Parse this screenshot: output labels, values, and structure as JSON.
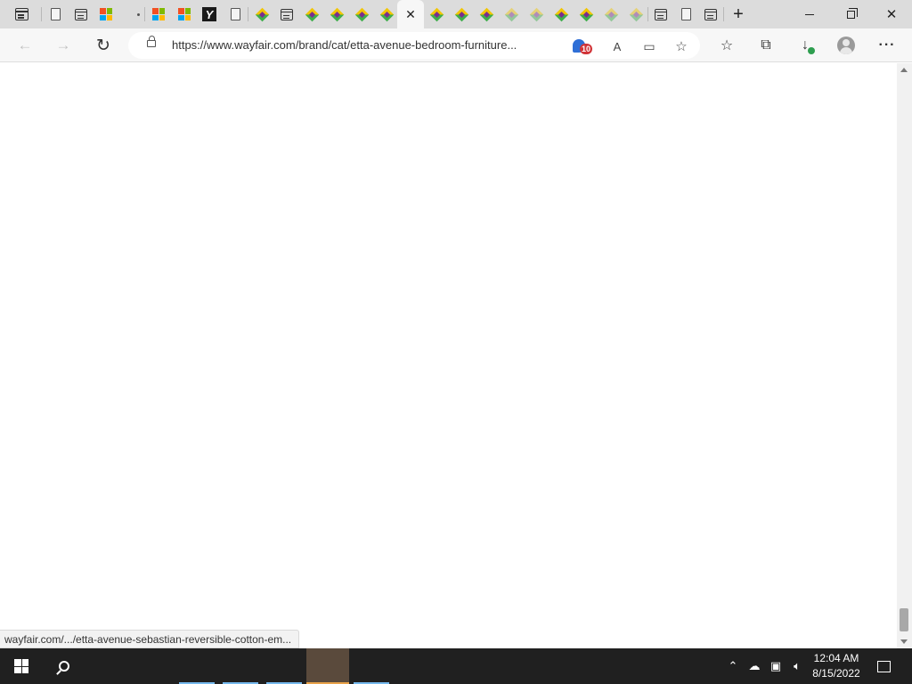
{
  "browser": {
    "address_url": "https://www.wayfair.com/brand/cat/etta-avenue-bedroom-furniture...",
    "tracking_badge_count": "10"
  },
  "tabs": [
    {
      "icon": "tab-actions-icon"
    },
    {
      "icon": "page-icon"
    },
    {
      "icon": "app-window-icon"
    },
    {
      "icon": "microsoft-logo-icon"
    },
    {
      "icon": "loading-dot-icon"
    },
    {
      "icon": "microsoft-logo-icon"
    },
    {
      "icon": "microsoft-logo-icon"
    },
    {
      "icon": "yahoo-logo-icon"
    },
    {
      "icon": "page-icon"
    },
    {
      "icon": "wayfair-logo-icon"
    },
    {
      "icon": "app-window-icon"
    },
    {
      "icon": "wayfair-logo-icon"
    },
    {
      "icon": "wayfair-logo-icon"
    },
    {
      "icon": "wayfair-logo-icon"
    },
    {
      "icon": "wayfair-logo-icon"
    },
    {
      "icon": "close-icon",
      "active": true
    },
    {
      "icon": "wayfair-logo-icon"
    },
    {
      "icon": "wayfair-logo-icon"
    },
    {
      "icon": "wayfair-logo-icon"
    },
    {
      "icon": "wayfair-logo-icon"
    },
    {
      "icon": "wayfair-logo-icon"
    },
    {
      "icon": "wayfair-logo-icon"
    },
    {
      "icon": "wayfair-logo-icon"
    },
    {
      "icon": "wayfair-logo-icon"
    },
    {
      "icon": "wayfair-logo-icon"
    },
    {
      "icon": "app-window-icon"
    },
    {
      "icon": "page-icon"
    },
    {
      "icon": "app-window-icon"
    }
  ],
  "status_bar": {
    "link_url": "wayfair.com/.../etta-avenue-sebastian-reversible-cotton-em..."
  },
  "taskbar": {
    "time": "12:04 AM",
    "date": "8/15/2022",
    "accent": "#76b9ed",
    "active_accent": "#e8a24a"
  }
}
